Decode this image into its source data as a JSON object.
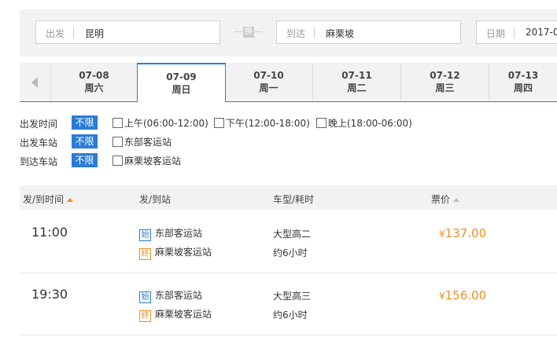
{
  "search": {
    "depart_label": "出发",
    "depart_value": "昆明",
    "swap_label": "换",
    "arrive_label": "到达",
    "arrive_value": "麻栗坡",
    "date_label": "日期",
    "date_value": "2017-0"
  },
  "dates": [
    {
      "date": "07-08",
      "weekday": "周六"
    },
    {
      "date": "07-09",
      "weekday": "周日",
      "active": true
    },
    {
      "date": "07-10",
      "weekday": "周一"
    },
    {
      "date": "07-11",
      "weekday": "周二"
    },
    {
      "date": "07-12",
      "weekday": "周三"
    },
    {
      "date": "07-13",
      "weekday": "周四"
    }
  ],
  "filters": {
    "depart_time": {
      "label": "出发时间",
      "no_limit": "不限",
      "options": [
        "上午(06:00-12:00)",
        "下午(12:00-18:00)",
        "晚上(18:00-06:00)"
      ]
    },
    "depart_station": {
      "label": "出发车站",
      "no_limit": "不限",
      "options": [
        "东部客运站"
      ]
    },
    "arrive_station": {
      "label": "到达车站",
      "no_limit": "不限",
      "options": [
        "麻栗坡客运站"
      ]
    }
  },
  "list_header": {
    "time": "发/到时间",
    "station": "发/到站",
    "vehicle": "车型/耗时",
    "price": "票价"
  },
  "badges": {
    "start": "始",
    "end": "終"
  },
  "currency": "¥",
  "rows": [
    {
      "time": "11:00",
      "from": "东部客运站",
      "to": "麻栗坡客运站",
      "vehicle": "大型高二",
      "duration": "约6小时",
      "price": "137.00"
    },
    {
      "time": "19:30",
      "from": "东部客运站",
      "to": "麻栗坡客运站",
      "vehicle": "大型高三",
      "duration": "约6小时",
      "price": "156.00"
    }
  ]
}
